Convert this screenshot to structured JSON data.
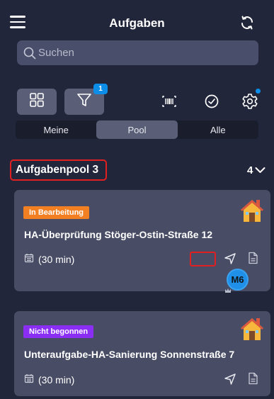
{
  "header": {
    "title": "Aufgaben",
    "menu_icon": "menu-icon",
    "sync_icon": "sync-icon"
  },
  "search": {
    "placeholder": "Suchen",
    "value": ""
  },
  "toolbar": {
    "filter_badge": "1",
    "icons": [
      "grid-icon",
      "filter-icon",
      "barcode-icon",
      "check-circle-icon",
      "gear-icon"
    ],
    "gear_notification_color": "#0c8de8"
  },
  "tabs": [
    {
      "label": "Meine",
      "active": false
    },
    {
      "label": "Pool",
      "active": true
    },
    {
      "label": "Alle",
      "active": false
    }
  ],
  "pool": {
    "title": "Aufgabenpool 3",
    "count": "4"
  },
  "tasks": [
    {
      "status": "In Bearbeitung",
      "status_color": "#f27f22",
      "title": "HA-Überprüfung Stöger-Ostin-Straße 12",
      "duration": "(30 min)",
      "assignee": "M6"
    },
    {
      "status": "Nicht begonnen",
      "status_color": "#8b2ef4",
      "title": "Unteraufgabe-HA-Sanierung Sonnenstraße 7",
      "duration": "(30 min)"
    }
  ],
  "colors": {
    "background": "#22263a",
    "card": "#484c64",
    "accent": "#0c8de8",
    "highlight": "#e02020"
  }
}
